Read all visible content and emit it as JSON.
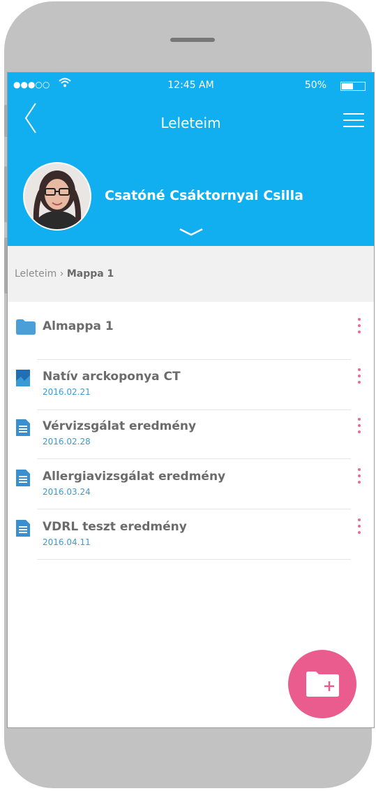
{
  "status_bar": {
    "signal": "●●●○○",
    "time": "12:45 AM",
    "battery": "50%",
    "battery_level": 0.5
  },
  "header": {
    "title": "Leleteim",
    "user_name": "Csatóné Csáktornyai Csilla"
  },
  "breadcrumb": {
    "root": "Leleteim",
    "separator": " › ",
    "current": "Mappa 1"
  },
  "items": [
    {
      "type": "folder",
      "name": "Almappa 1",
      "date": ""
    },
    {
      "type": "image",
      "name": "Natív arckoponya CT",
      "date": "2016.02.21"
    },
    {
      "type": "document",
      "name": "Vérvizsgálat eredmény",
      "date": "2016.02.28"
    },
    {
      "type": "document",
      "name": "Allergiavizsgálat eredmény",
      "date": "2016.03.24"
    },
    {
      "type": "document",
      "name": "VDRL teszt eredmény",
      "date": "2016.04.11"
    }
  ],
  "colors": {
    "header": "#11aff0",
    "accent_pink": "#ea5c8e",
    "date_blue": "#3a9ad6"
  },
  "icons": {
    "fab": "add-folder-icon"
  }
}
